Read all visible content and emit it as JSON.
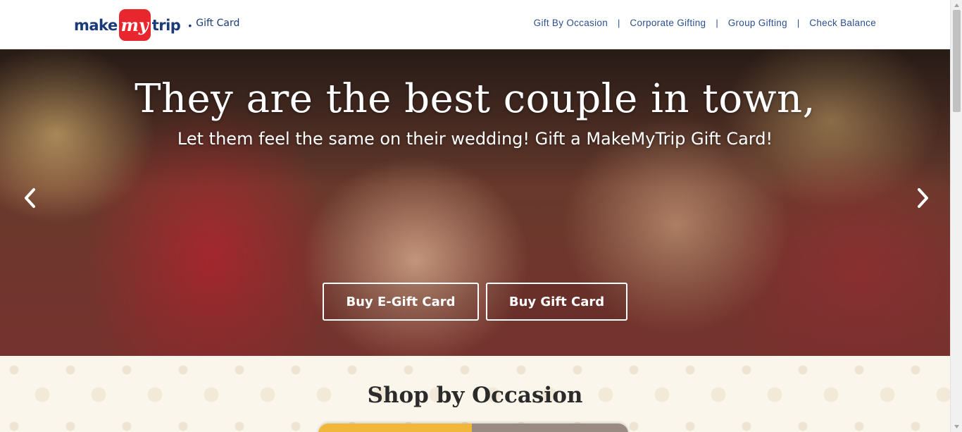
{
  "header": {
    "logo": {
      "make": "make",
      "my": "my",
      "trip": "trip",
      "sub": "Gift Card",
      "brand_color": "#e8262d"
    },
    "nav": [
      {
        "label": "Gift By Occasion"
      },
      {
        "label": "Corporate Gifting"
      },
      {
        "label": "Group Gifting"
      },
      {
        "label": "Check Balance"
      }
    ],
    "separator": "|"
  },
  "hero": {
    "title": "They are the best couple in town,",
    "subtitle": "Let them feel the same on their wedding! Gift a MakeMyTrip Gift Card!",
    "buttons": {
      "e_gift": "Buy E-Gift Card",
      "gift": "Buy Gift Card"
    },
    "prev_icon": "chevron-left-icon",
    "next_icon": "chevron-right-icon"
  },
  "occasion": {
    "title": "Shop by Occasion"
  }
}
